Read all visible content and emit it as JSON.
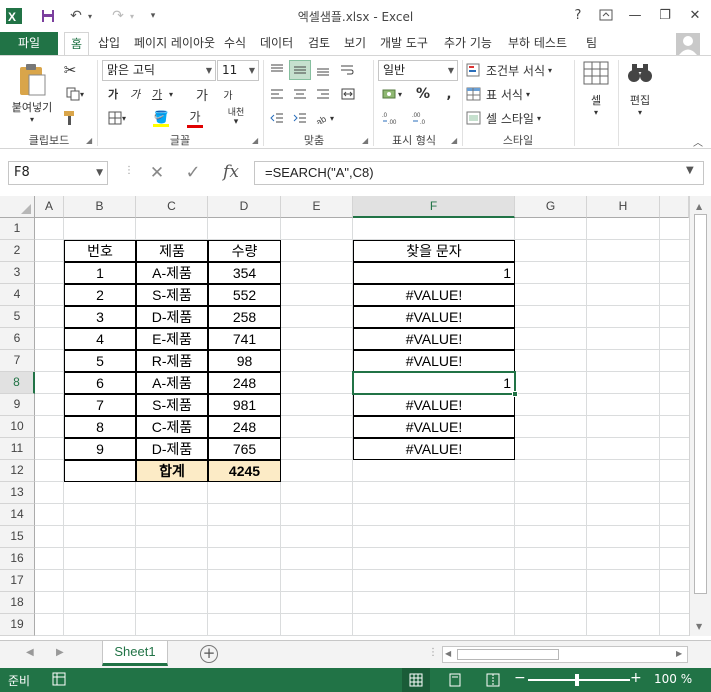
{
  "window": {
    "title": "엑셀샘플.xlsx - Excel",
    "help": "?",
    "minimize": "—",
    "restore": "❐",
    "close": "✕"
  },
  "quick_access": {
    "save": "💾",
    "undo": "↶",
    "redo": "↷",
    "more": "▾"
  },
  "tabs": [
    "파일",
    "홈",
    "삽입",
    "페이지 레이아웃",
    "수식",
    "데이터",
    "검토",
    "보기",
    "개발 도구",
    "추가 기능",
    "부하 테스트",
    "팀"
  ],
  "active_tab": "홈",
  "ribbon": {
    "clipboard": {
      "paste": "붙여넣기",
      "label": "클립보드"
    },
    "font": {
      "name": "맑은 고딕",
      "size": "11",
      "bold": "가",
      "italic": "가",
      "underline": "가",
      "grow": "가",
      "shrink": "가",
      "label": "글꼴",
      "phonetic": "내천"
    },
    "align": {
      "label": "맞춤"
    },
    "number": {
      "format": "일반",
      "percent": "%",
      "label": "표시 형식"
    },
    "style": {
      "conditional": "조건부 서식",
      "table": "표 서식",
      "cell_style": "셀 스타일",
      "label": "스타일"
    },
    "cells": {
      "label": "셀"
    },
    "editing": {
      "label": "편집"
    }
  },
  "formula_bar": {
    "name_box": "F8",
    "formula": "=SEARCH(\"A\",C8)",
    "fx": "fx",
    "cancel": "✕",
    "enter": "✓"
  },
  "columns": [
    "A",
    "B",
    "C",
    "D",
    "E",
    "F",
    "G",
    "H"
  ],
  "selected_column": "F",
  "rows": [
    "1",
    "2",
    "3",
    "4",
    "5",
    "6",
    "7",
    "8",
    "9",
    "10",
    "11",
    "12",
    "13",
    "14",
    "15",
    "16",
    "17",
    "18",
    "19"
  ],
  "selected_row": "8",
  "table": {
    "headers": [
      "번호",
      "제품",
      "수량"
    ],
    "rows": [
      [
        "1",
        "A-제품",
        "354"
      ],
      [
        "2",
        "S-제품",
        "552"
      ],
      [
        "3",
        "D-제품",
        "258"
      ],
      [
        "4",
        "E-제품",
        "741"
      ],
      [
        "5",
        "R-제품",
        "98"
      ],
      [
        "6",
        "A-제품",
        "248"
      ],
      [
        "7",
        "S-제품",
        "981"
      ],
      [
        "8",
        "C-제품",
        "248"
      ],
      [
        "9",
        "D-제품",
        "765"
      ]
    ],
    "total_label": "합계",
    "total_value": "4245"
  },
  "search_col": {
    "header": "찾을 문자",
    "values": [
      "1",
      "#VALUE!",
      "#VALUE!",
      "#VALUE!",
      "#VALUE!",
      "1",
      "#VALUE!",
      "#VALUE!",
      "#VALUE!"
    ]
  },
  "sheet_tabs": [
    "Sheet1"
  ],
  "status": {
    "ready": "준비",
    "zoom": "100 %"
  },
  "colors": {
    "accent": "#217346",
    "total_fill": "#fcebc6",
    "gridline": "#dadcdd"
  }
}
